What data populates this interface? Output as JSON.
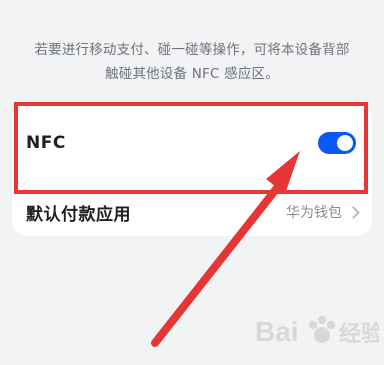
{
  "description": {
    "line1": "若要进行移动支付、碰一碰等操作，可将本设备背部",
    "line2": "触碰其他设备 NFC 感应区。"
  },
  "settings": {
    "nfc": {
      "label": "NFC",
      "enabled": true
    },
    "payment": {
      "label": "默认付款应用",
      "value": "华为钱包"
    }
  },
  "watermark": {
    "text": "Bai 经验"
  },
  "colors": {
    "accent": "#0a59f7",
    "annotation": "#e53535"
  },
  "icons": {
    "toggle": "switch-toggle-icon",
    "chevron": "chevron-right-icon",
    "arrow": "red-arrow-icon",
    "watermark": "baidu-paw-icon"
  }
}
